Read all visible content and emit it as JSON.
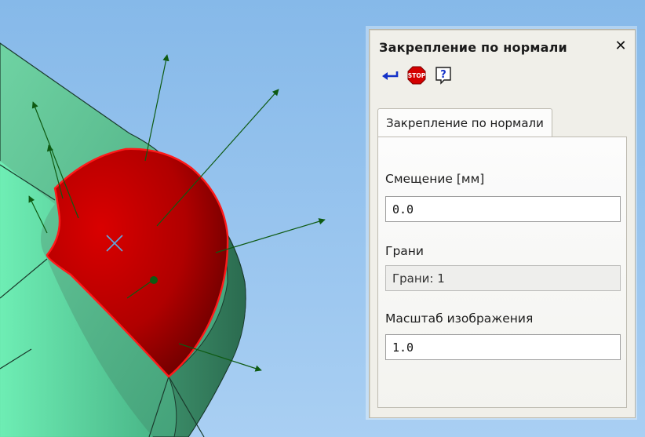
{
  "panel": {
    "title": "Закрепление по нормали",
    "close_glyph": "✕",
    "toolbar": [
      {
        "icon": "apply-arrow-icon"
      },
      {
        "icon": "stop-icon",
        "label": "STOP"
      },
      {
        "icon": "help-icon",
        "label": "?"
      }
    ],
    "tab_label": "Закрепление по нормали",
    "offset": {
      "label": "Смещение [мм]",
      "value": "0.0"
    },
    "faces": {
      "label": "Грани",
      "value": "Грани: 1"
    },
    "scale": {
      "label": "Масштаб изображения",
      "value": "1.0"
    }
  },
  "colors": {
    "sky": "#7fb2e4",
    "body_green": "#3f9773",
    "face_red": "#c20000",
    "arrow_green": "#0e5a12",
    "panel_bg": "#f0efe9"
  }
}
